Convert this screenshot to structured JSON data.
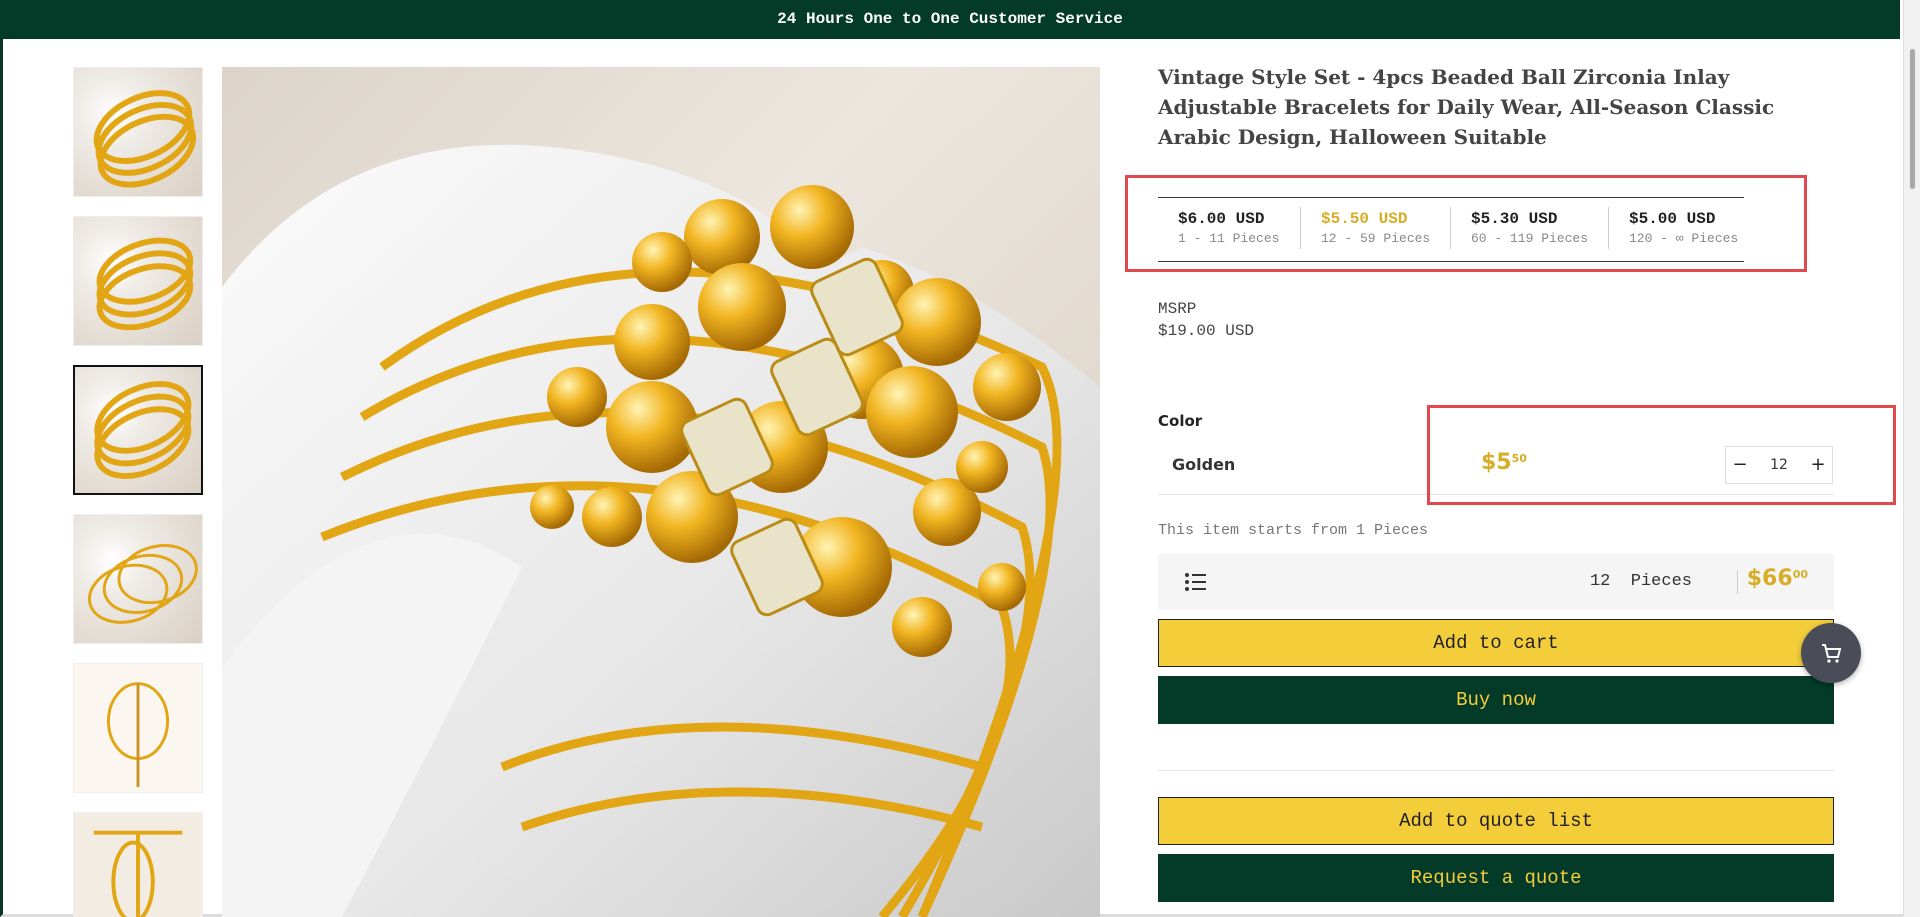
{
  "topbar": {
    "text": "24 Hours One to One Customer Service"
  },
  "product": {
    "title": "Vintage Style Set - 4pcs Beaded Ball Zirconia Inlay Adjustable Bracelets for Daily Wear, All-Season Classic Arabic Design, Halloween Suitable"
  },
  "tiers": [
    {
      "price": "$6.00 USD",
      "range": "1 - 11 Pieces",
      "active": false
    },
    {
      "price": "$5.50 USD",
      "range": "12 - 59 Pieces",
      "active": true
    },
    {
      "price": "$5.30 USD",
      "range": "60 - 119 Pieces",
      "active": false
    },
    {
      "price": "$5.00 USD",
      "range": "120 - ∞ Pieces",
      "active": false
    }
  ],
  "msrp": {
    "label": "MSRP",
    "value": "$19.00 USD"
  },
  "variant": {
    "label": "Color",
    "value": "Golden",
    "unit_price_main": "$5",
    "unit_price_cents": "50",
    "quantity": "12",
    "minus": "−",
    "plus": "+"
  },
  "starts_text": "This item starts from 1 Pieces",
  "summary": {
    "quantity": "12",
    "unit": "Pieces",
    "total_main": "$66",
    "total_cents": "00"
  },
  "buttons": {
    "add_to_cart": "Add to cart",
    "buy_now": "Buy now",
    "add_to_quote": "Add to quote list",
    "request_quote": "Request a quote"
  },
  "icons": {
    "list": "list-icon",
    "cart": "cart-icon"
  },
  "colors": {
    "brand_green": "#033a28",
    "accent_gold": "#d7ad26",
    "button_yellow": "#f4cd3b",
    "highlight_red": "#e04a4f"
  }
}
